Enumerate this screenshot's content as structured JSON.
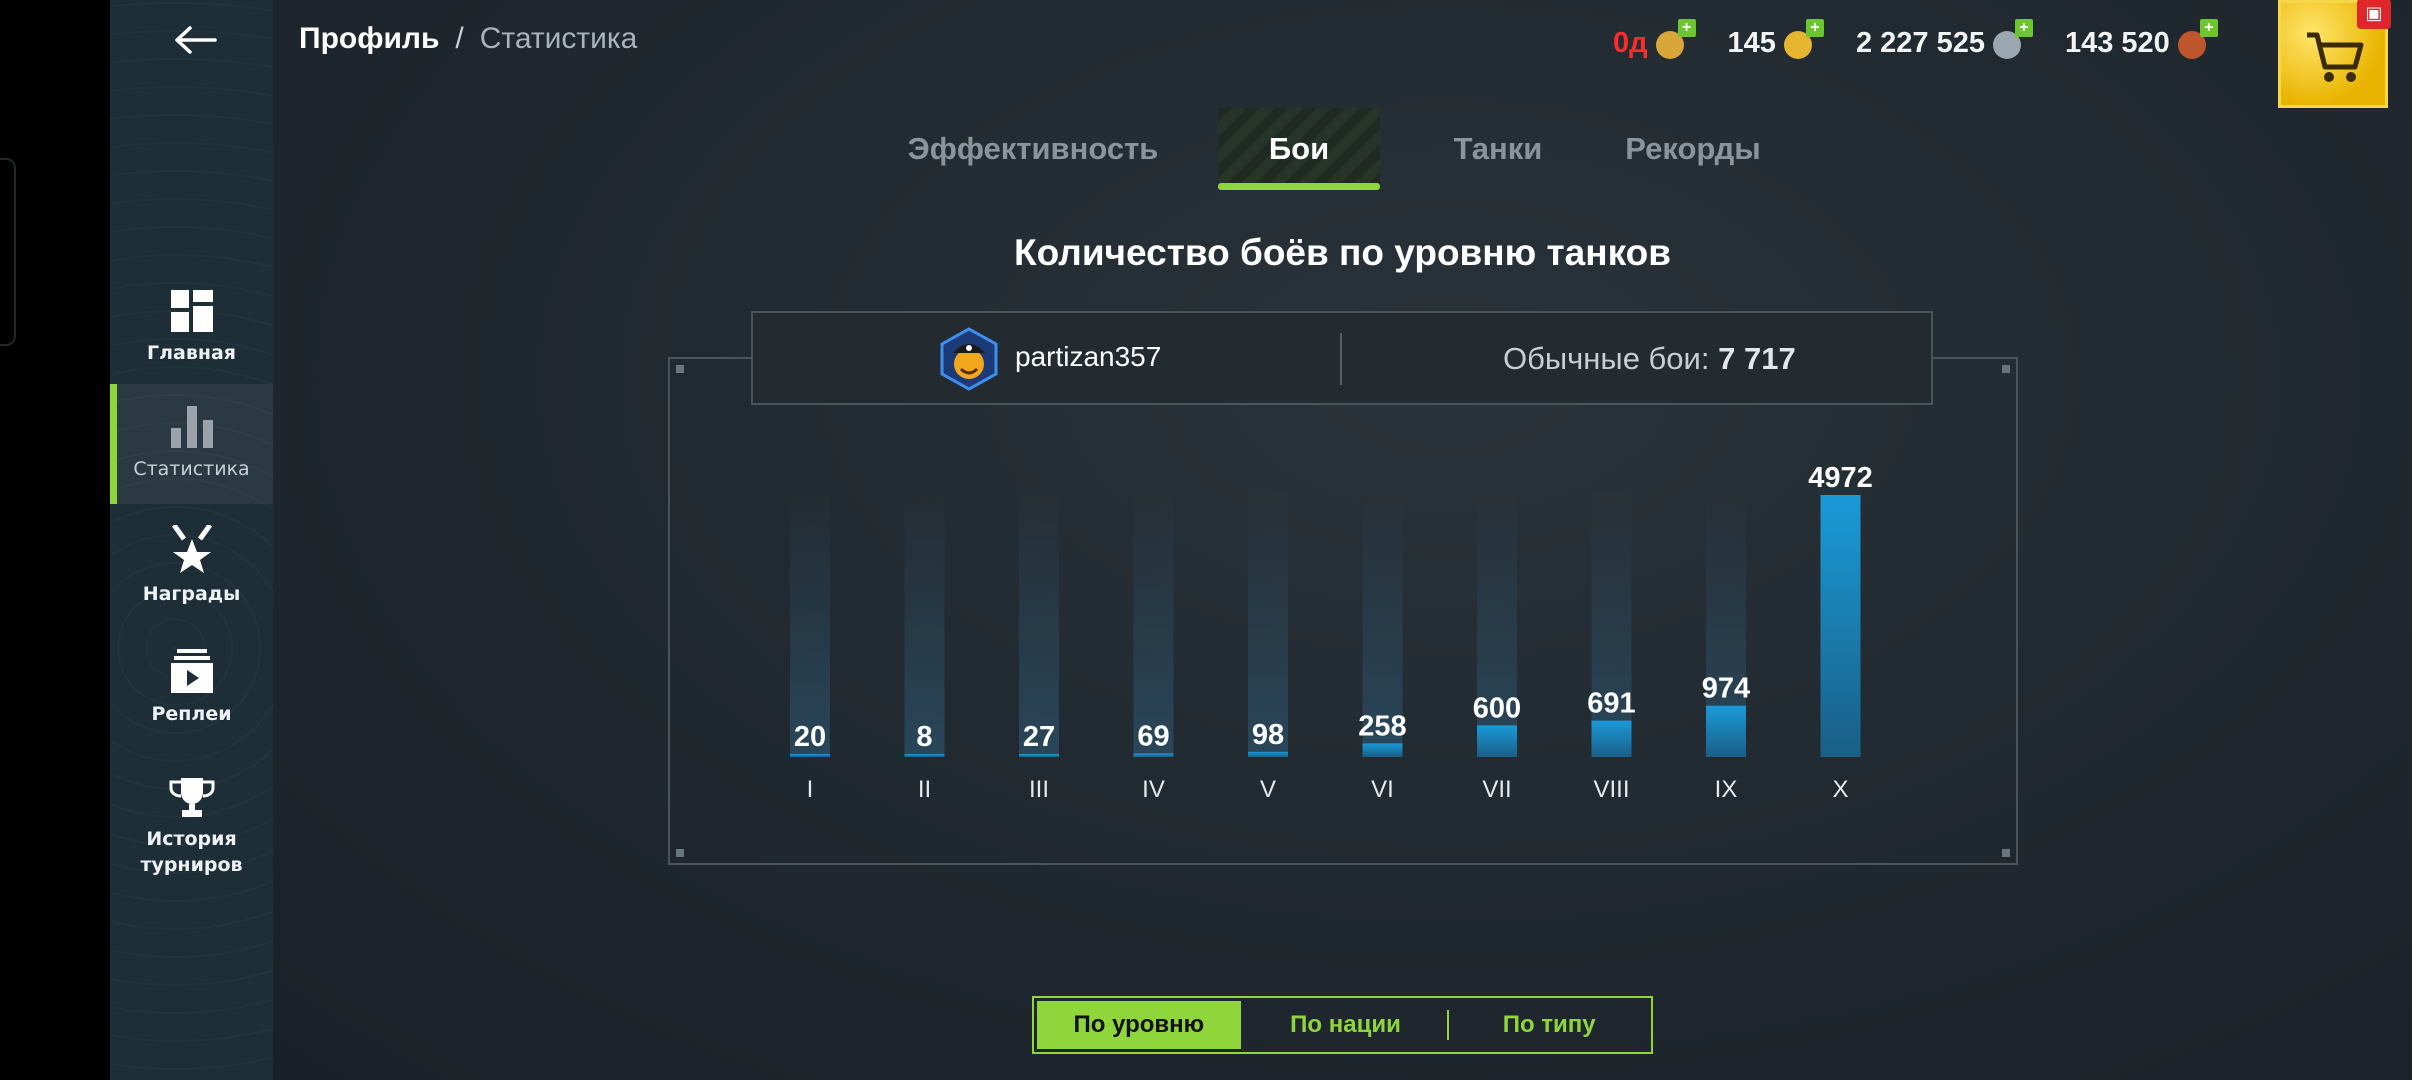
{
  "breadcrumb": {
    "profile": "Профиль",
    "separator": "/",
    "current": "Статистика"
  },
  "currencies": [
    {
      "value": "0д",
      "icon": "premium-icon",
      "color": "#ff2a2a",
      "coin": "#d9a63a"
    },
    {
      "value": "145",
      "icon": "gold-icon",
      "color": "#f2f4f5",
      "coin": "#e6b52f"
    },
    {
      "value": "2 227 525",
      "icon": "credits-icon",
      "color": "#f2f4f5",
      "coin": "#9aa7b1"
    },
    {
      "value": "143 520",
      "icon": "free-xp-icon",
      "color": "#f2f4f5",
      "coin": "#c0562d"
    }
  ],
  "sidebar": {
    "items": [
      {
        "label": "Главная",
        "icon": "dashboard-icon"
      },
      {
        "label": "Статистика",
        "icon": "bar-chart-icon",
        "active": true
      },
      {
        "label": "Награды",
        "icon": "awards-icon"
      },
      {
        "label": "Реплеи",
        "icon": "replays-icon"
      },
      {
        "label": "История турниров",
        "icon": "trophy-icon"
      }
    ]
  },
  "tabs": [
    {
      "label": "Эффективность"
    },
    {
      "label": "Бои",
      "active": true
    },
    {
      "label": "Танки"
    },
    {
      "label": "Рекорды"
    }
  ],
  "chart_title": "Количество боёв по уровню танков",
  "player": {
    "name": "partizan357",
    "battles_label": "Обычные бои:",
    "battles_value": "7 717"
  },
  "chart_data": {
    "type": "bar",
    "title": "Количество боёв по уровню танков",
    "categories": [
      "I",
      "II",
      "III",
      "IV",
      "V",
      "VI",
      "VII",
      "VIII",
      "IX",
      "X"
    ],
    "values": [
      20,
      8,
      27,
      69,
      98,
      258,
      600,
      691,
      974,
      4972
    ],
    "ylim": [
      0,
      4972
    ],
    "bar_color": "#1a9ad8",
    "track_color": "#2a4a5f"
  },
  "grouping": [
    {
      "label": "По уровню",
      "active": true
    },
    {
      "label": "По нации"
    },
    {
      "label": "По типу"
    }
  ],
  "colors": {
    "accent": "#8fd63c",
    "negative": "#ff2a2a"
  }
}
